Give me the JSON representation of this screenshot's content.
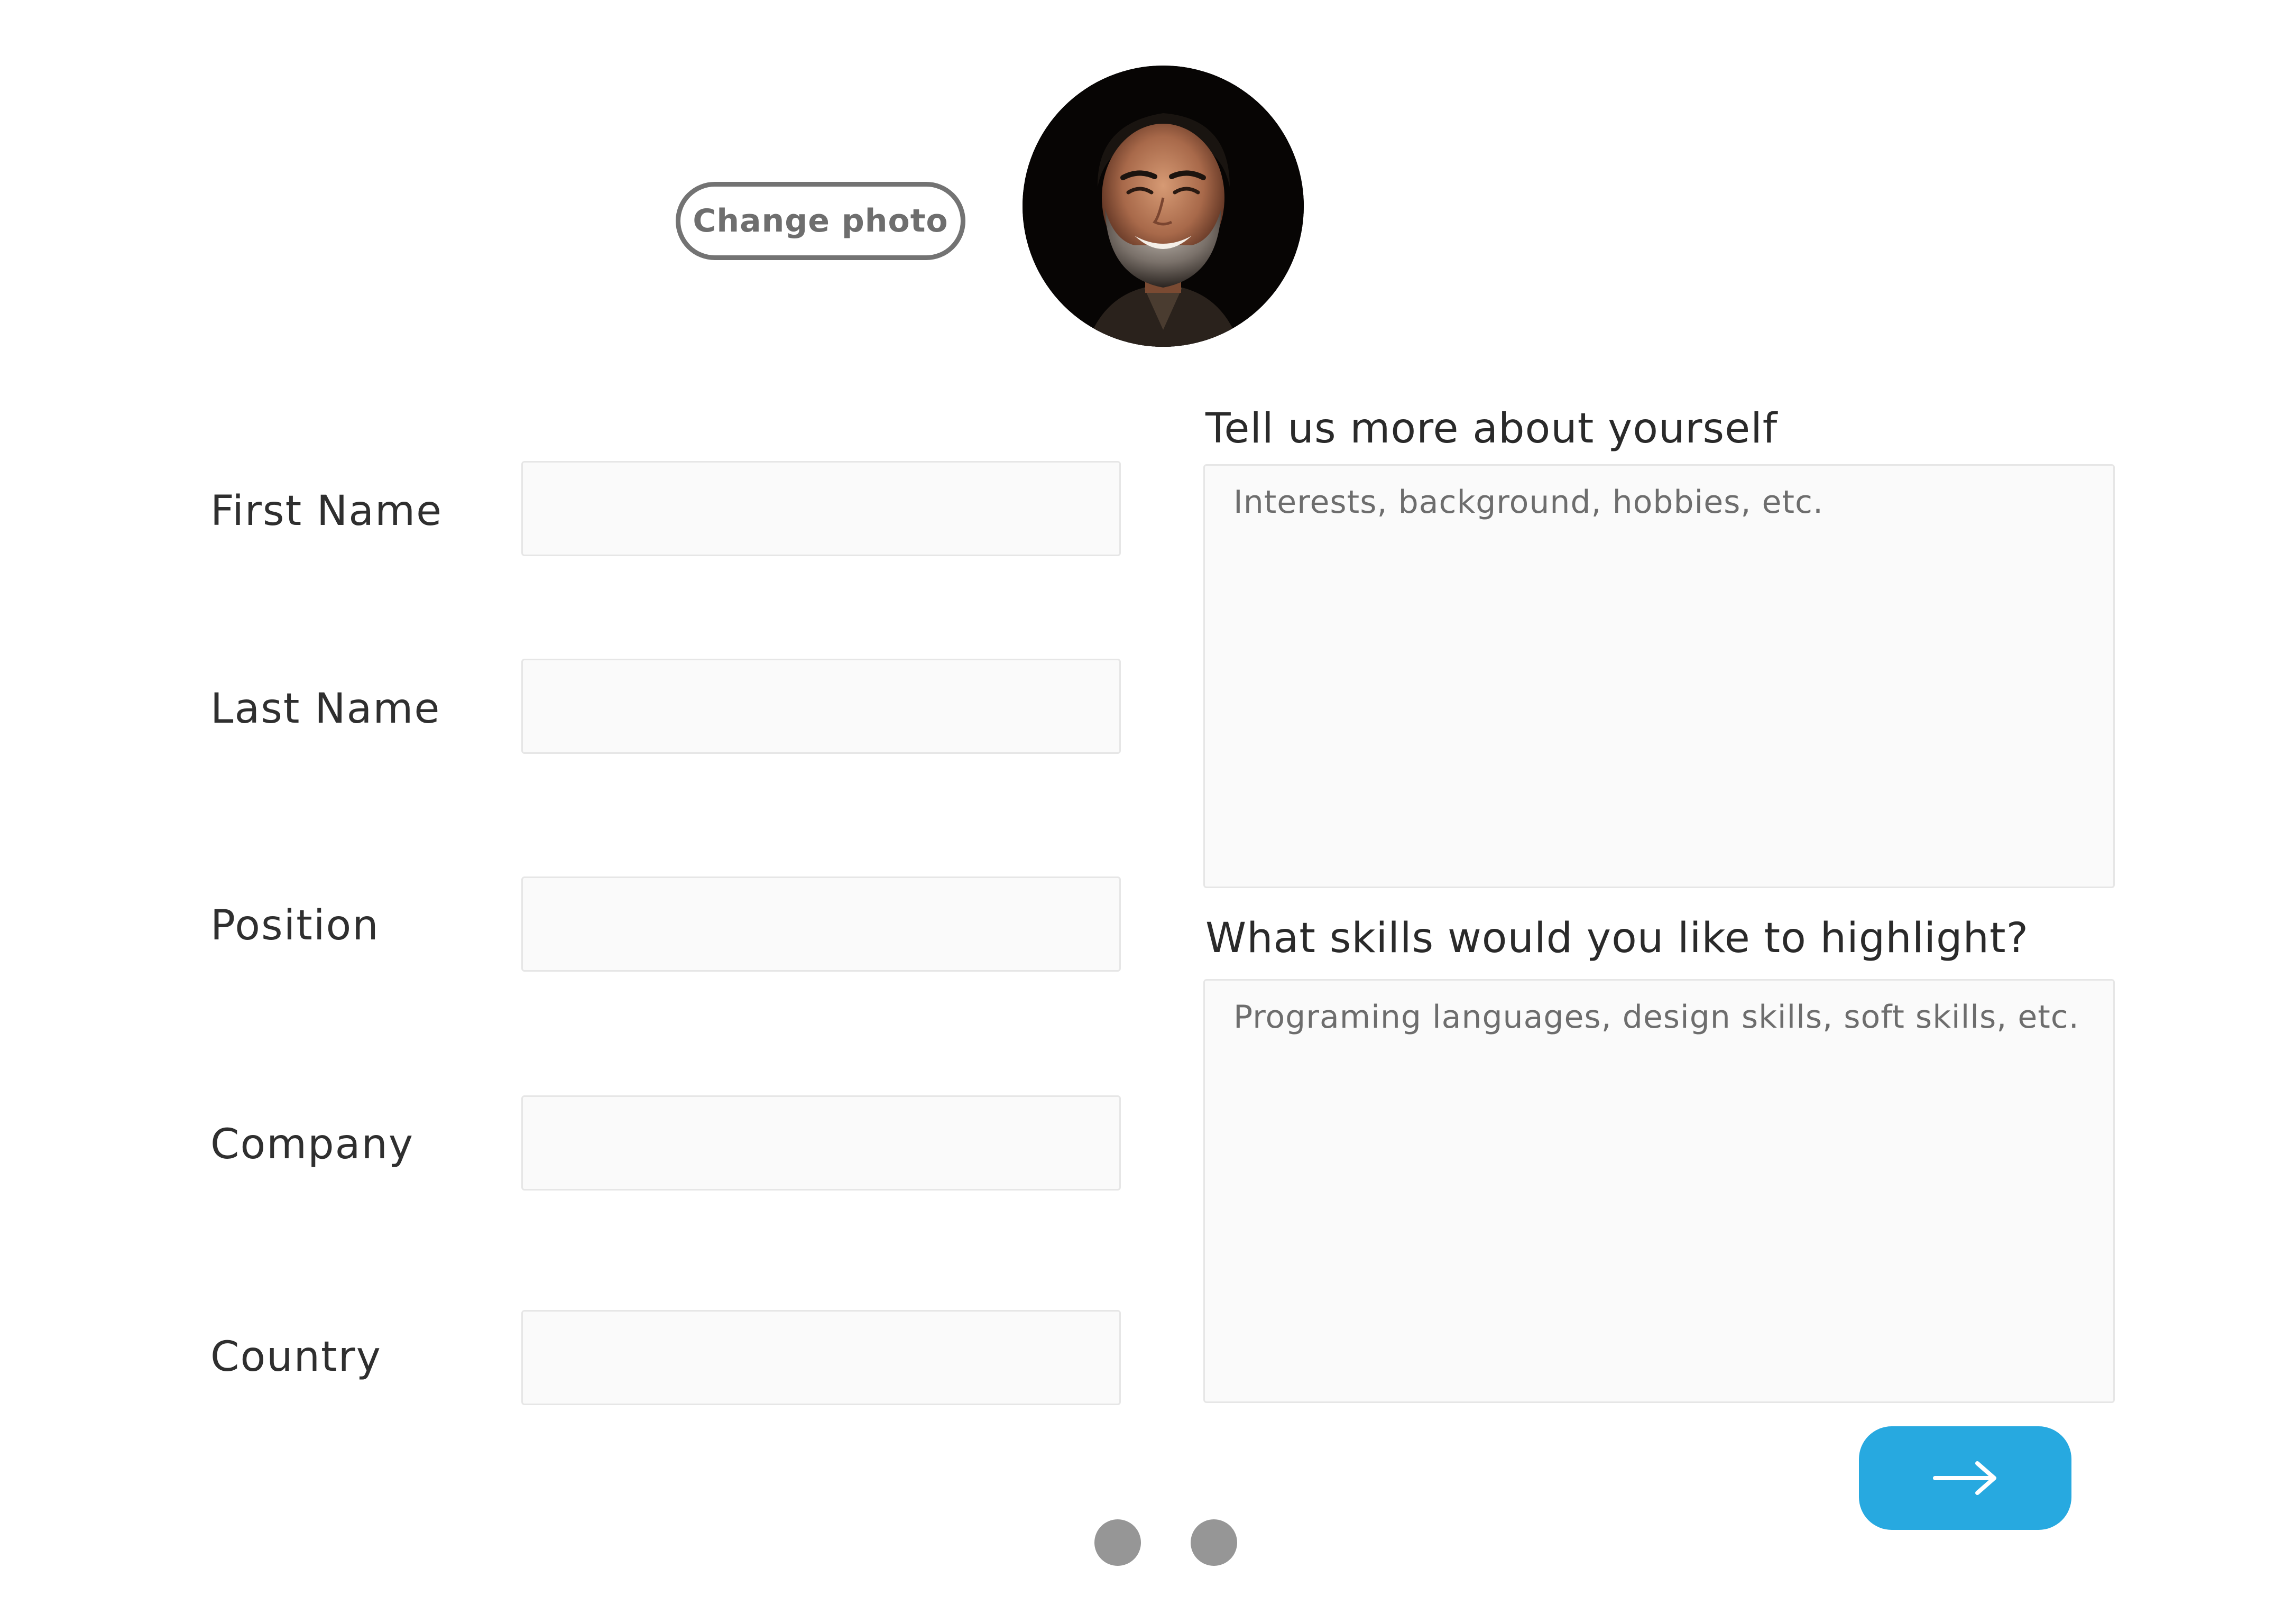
{
  "profile": {
    "change_photo_label": "Change photo",
    "avatar_alt": "Profile photo"
  },
  "form": {
    "first_name_label": "First Name",
    "first_name_value": "",
    "last_name_label": "Last Name",
    "last_name_value": "",
    "position_label": "Position",
    "position_value": "",
    "company_label": "Company",
    "company_value": "",
    "country_label": "Country",
    "country_value": ""
  },
  "about": {
    "heading": "Tell us more about yourself",
    "placeholder": "Interests, background, hobbies, etc.",
    "value": ""
  },
  "skills": {
    "heading": "What skills would you like to highlight?",
    "placeholder": "Programing languages, design skills, soft skills, etc.",
    "value": ""
  },
  "navigation": {
    "next_icon": "arrow-right-icon",
    "pages": [
      "page-1",
      "page-2"
    ]
  },
  "colors": {
    "accent": "#27a9e0",
    "dot": "#969696",
    "outline_button": "#737373"
  }
}
